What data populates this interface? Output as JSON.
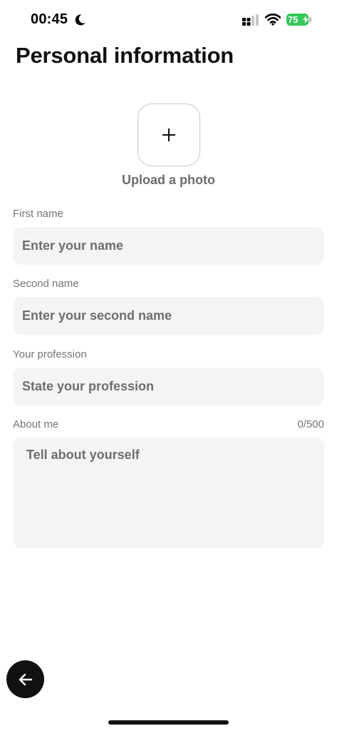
{
  "status_bar": {
    "time": "00:45",
    "battery_percent": "75",
    "icons": [
      "moon-icon",
      "signal-icon",
      "wifi-icon",
      "battery-icon",
      "bolt-icon"
    ],
    "battery_color": "#34c759"
  },
  "page": {
    "title": "Personal information"
  },
  "upload": {
    "icon": "plus-icon",
    "label": "Upload a photo"
  },
  "form": {
    "first_name": {
      "label": "First name",
      "placeholder": "Enter your name",
      "value": ""
    },
    "second_name": {
      "label": "Second name",
      "placeholder": "Enter your second name",
      "value": ""
    },
    "profession": {
      "label": "Your profession",
      "placeholder": "State your profession",
      "value": ""
    },
    "about": {
      "label": "About me",
      "counter": "0/500",
      "placeholder": "Tell about yourself",
      "value": ""
    }
  },
  "navigation": {
    "back_icon": "arrow-left-icon",
    "back_button_color": "#111111"
  }
}
